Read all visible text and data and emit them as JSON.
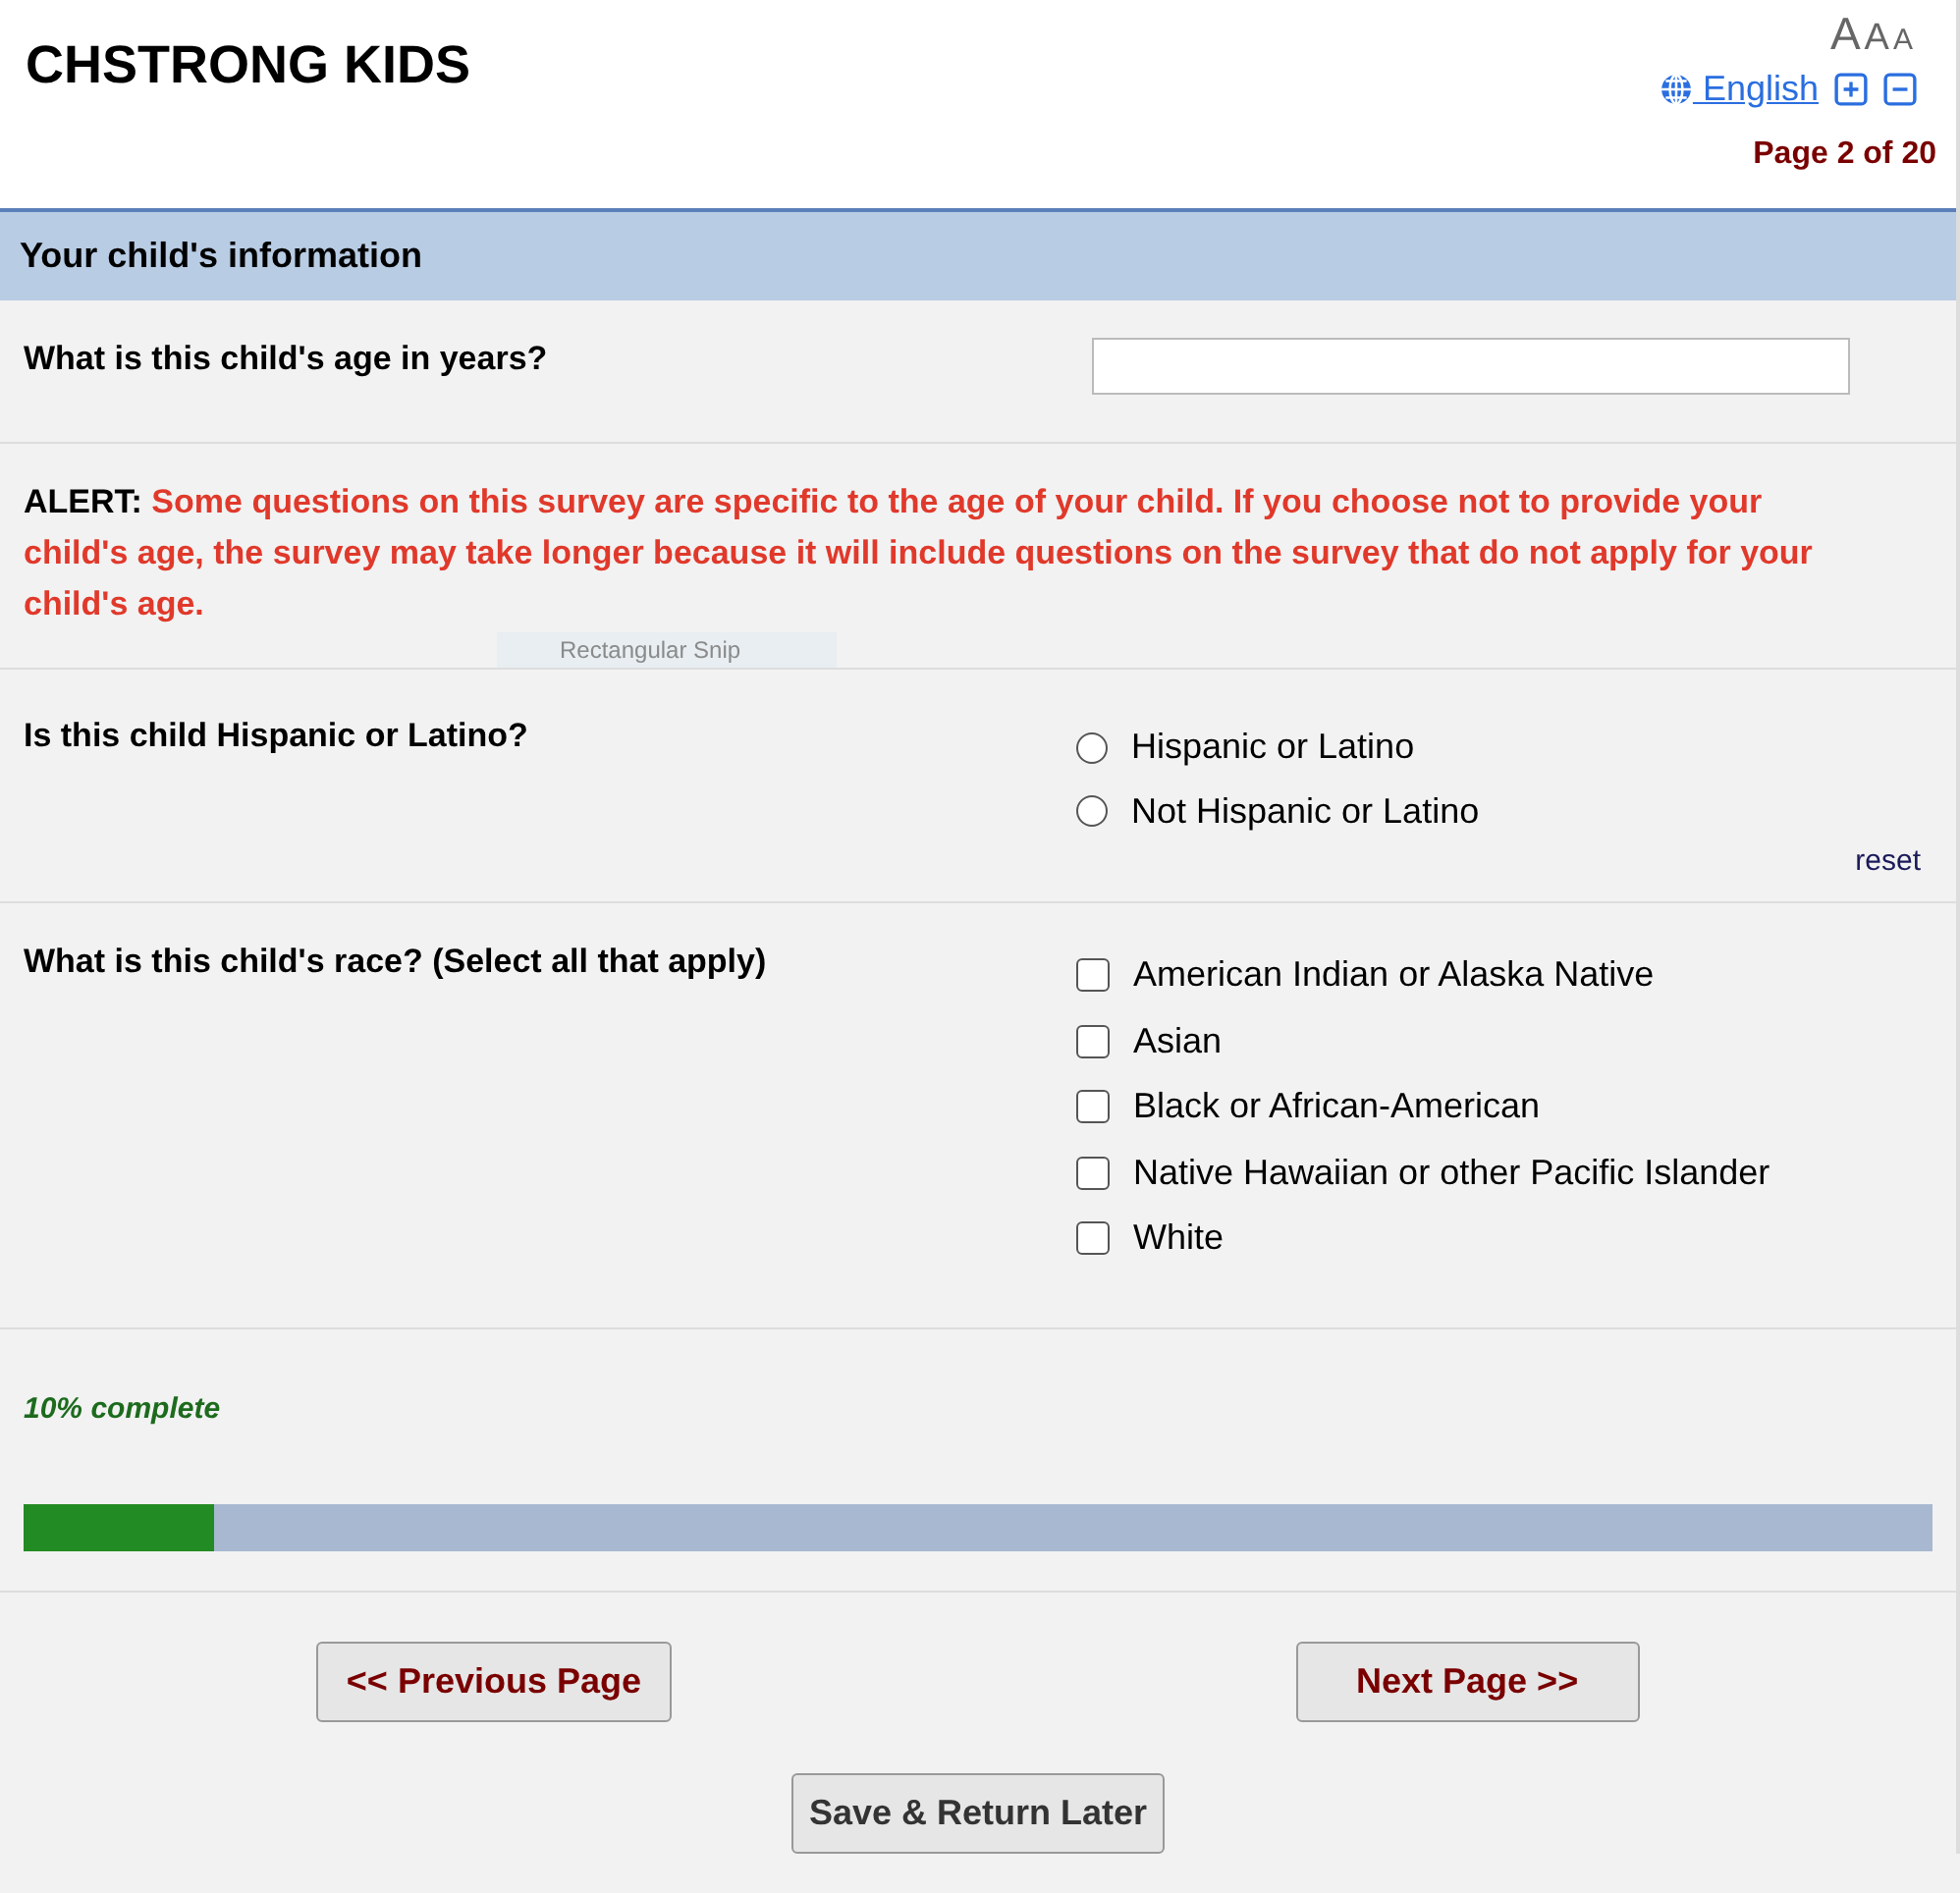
{
  "header": {
    "title": "CHSTRONG KIDS",
    "font_sizes": [
      "A",
      "A",
      "A"
    ],
    "language": "English",
    "page_indicator": "Page 2 of 20"
  },
  "section": {
    "title": "Your child's information"
  },
  "questions": [
    {
      "kind": "text",
      "label": "What is this child's age in years?"
    },
    {
      "kind": "alert",
      "prefix": "ALERT:",
      "text": "Some questions on this survey are specific to the age of your child. If you choose not to provide your child's age, the survey may take longer because it will include questions on the survey that do not apply for your child's age."
    },
    {
      "kind": "radio",
      "label": "Is this child Hispanic or Latino?",
      "options": [
        {
          "label": "Hispanic or Latino",
          "selected": false
        },
        {
          "label": "Not Hispanic or Latino",
          "selected": false
        }
      ],
      "reset": "reset"
    },
    {
      "kind": "checkbox",
      "label": "What is this child's race? (Select all that apply)",
      "options": [
        {
          "label": "American Indian or Alaska Native",
          "checked": false
        },
        {
          "label": "Asian",
          "checked": false
        },
        {
          "label": "Black or African-American",
          "checked": false
        },
        {
          "label": "Native Hawaiian or other Pacific Islander",
          "checked": false
        },
        {
          "label": "White",
          "checked": false
        }
      ]
    }
  ],
  "progress": {
    "label": "10% complete",
    "level": 0.1
  },
  "buttons": {
    "previous": "<< Previous Page",
    "next": "Next Page >>",
    "save": "Save & Return Later"
  },
  "snip_tooltip": "Rectangular Snip"
}
